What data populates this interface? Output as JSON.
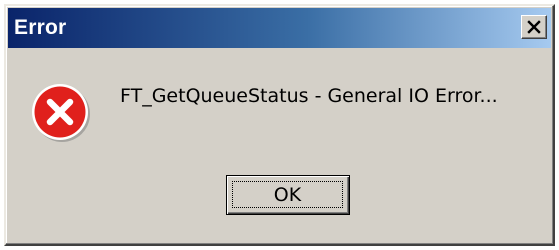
{
  "window": {
    "title": "Error",
    "close_icon": "close-icon"
  },
  "content": {
    "icon": "error-icon",
    "message": "FT_GetQueueStatus - General IO Error..."
  },
  "buttons": {
    "ok_label": "OK"
  },
  "colors": {
    "titlebar_start": "#0a246a",
    "titlebar_end": "#a6caf0",
    "dialog_face": "#d4d0c8",
    "error_red": "#e0201c"
  }
}
